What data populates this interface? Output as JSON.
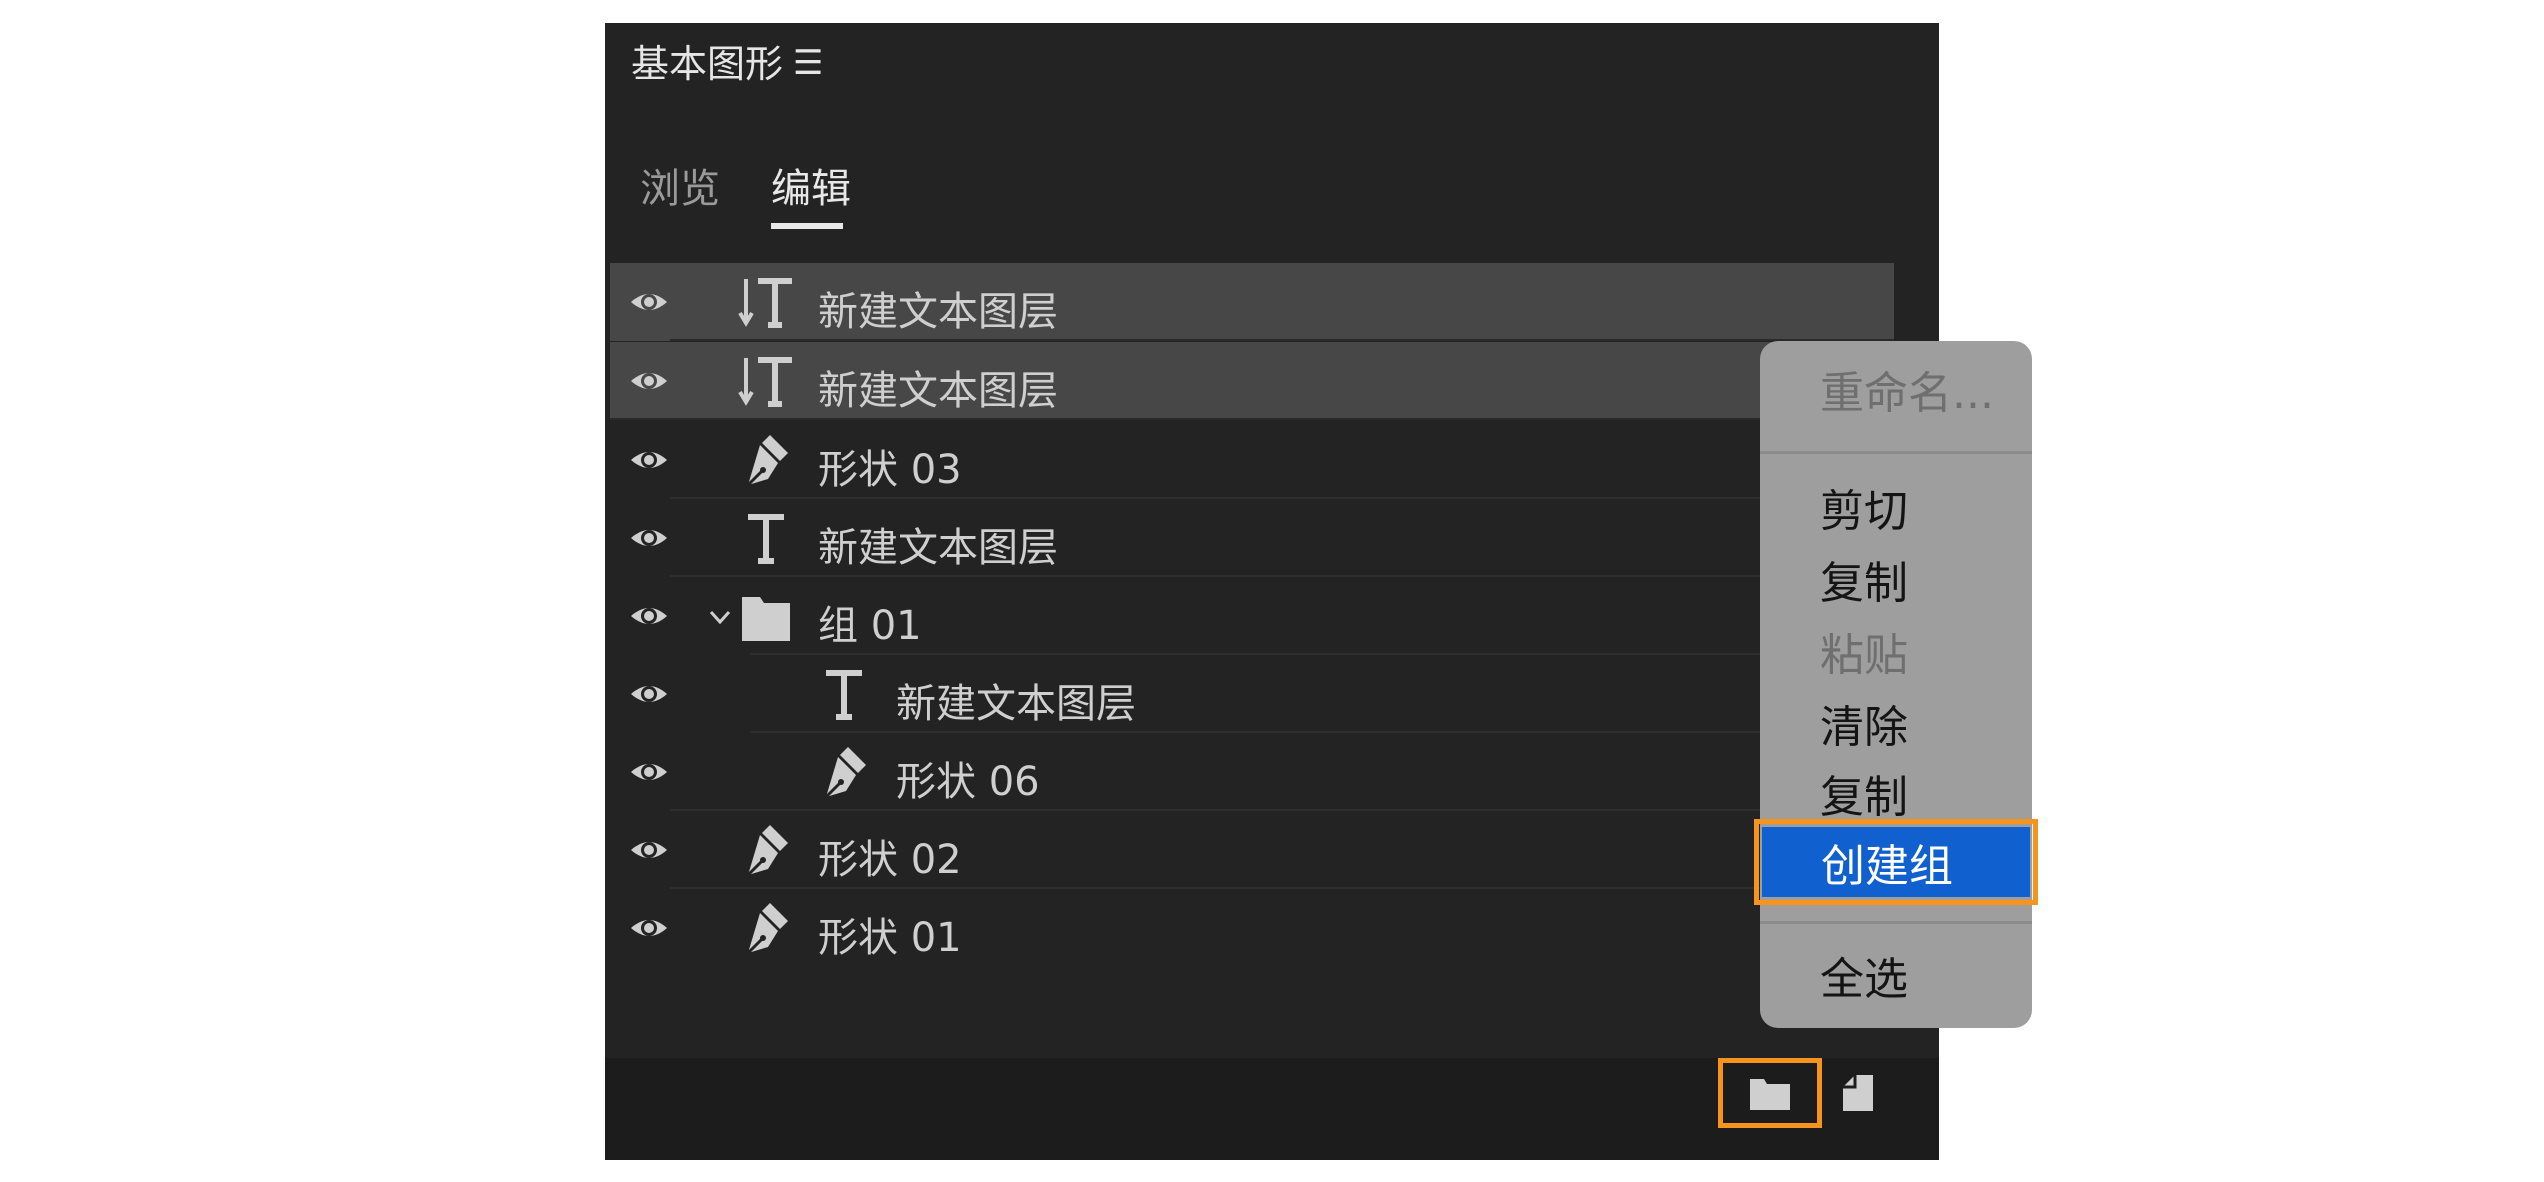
{
  "panel": {
    "title": "基本图形",
    "menu_icon": "☰"
  },
  "tabs": [
    {
      "label": "浏览",
      "active": false
    },
    {
      "label": "编辑",
      "active": true
    }
  ],
  "layers": [
    {
      "label": "新建文本图层",
      "icon": "vertical-text-icon",
      "selected": true,
      "indent": 0
    },
    {
      "label": "新建文本图层",
      "icon": "vertical-text-icon",
      "selected": true,
      "indent": 0
    },
    {
      "label": "形状 03",
      "icon": "pen-icon",
      "selected": false,
      "indent": 0
    },
    {
      "label": "新建文本图层",
      "icon": "text-icon",
      "selected": false,
      "indent": 0
    },
    {
      "label": "组 01",
      "icon": "folder-icon",
      "selected": false,
      "indent": 0,
      "expanded": true
    },
    {
      "label": "新建文本图层",
      "icon": "text-icon",
      "selected": false,
      "indent": 1
    },
    {
      "label": "形状 06",
      "icon": "pen-icon",
      "selected": false,
      "indent": 1
    },
    {
      "label": "形状 02",
      "icon": "pen-icon",
      "selected": false,
      "indent": 0
    },
    {
      "label": "形状 01",
      "icon": "pen-icon",
      "selected": false,
      "indent": 0
    }
  ],
  "context_menu": {
    "items": [
      {
        "label": "重命名...",
        "enabled": false
      },
      {
        "label": "剪切",
        "enabled": true
      },
      {
        "label": "复制",
        "enabled": true
      },
      {
        "label": "粘贴",
        "enabled": false
      },
      {
        "label": "清除",
        "enabled": true
      },
      {
        "label": "复制",
        "enabled": true
      },
      {
        "label": "创建组",
        "enabled": true,
        "highlighted": true
      },
      {
        "label": "全选",
        "enabled": true
      }
    ]
  },
  "colors": {
    "panel_bg": "#232323",
    "selected_row": "#474747",
    "highlight_outline": "#f7941d",
    "menu_highlight": "#1160cf",
    "menu_bg": "#9e9e9e"
  }
}
